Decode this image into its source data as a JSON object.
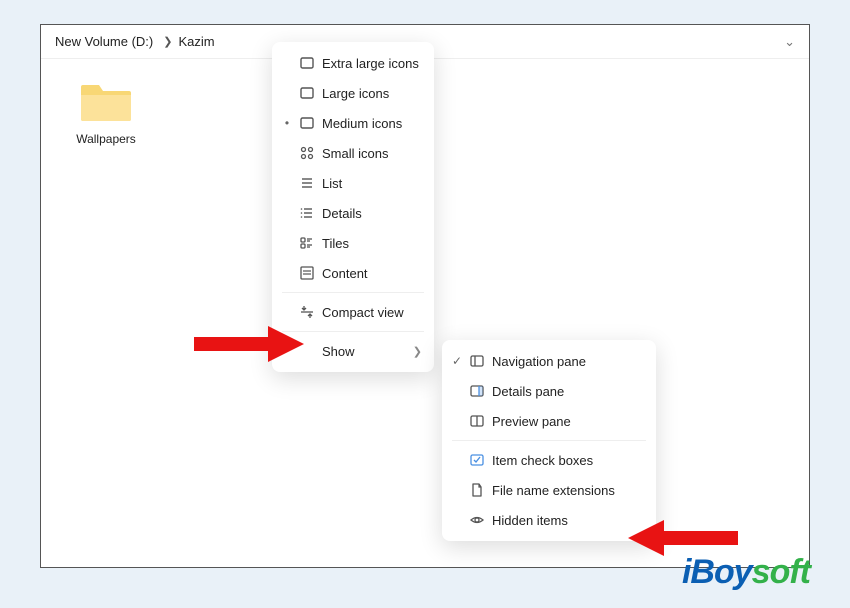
{
  "breadcrumb": {
    "item1": "New Volume (D:)",
    "item2": "Kazim"
  },
  "folder": {
    "name": "Wallpapers"
  },
  "viewMenu": {
    "items": [
      {
        "label": "Extra large icons",
        "icon": "xlarge"
      },
      {
        "label": "Large icons",
        "icon": "large"
      },
      {
        "label": "Medium icons",
        "icon": "medium",
        "selected": true
      },
      {
        "label": "Small icons",
        "icon": "small"
      },
      {
        "label": "List",
        "icon": "list"
      },
      {
        "label": "Details",
        "icon": "details"
      },
      {
        "label": "Tiles",
        "icon": "tiles"
      },
      {
        "label": "Content",
        "icon": "content"
      }
    ],
    "compact": {
      "label": "Compact view"
    },
    "show": {
      "label": "Show"
    }
  },
  "showMenu": {
    "items": [
      {
        "label": "Navigation pane",
        "icon": "navpane",
        "checked": true
      },
      {
        "label": "Details pane",
        "icon": "detailspane"
      },
      {
        "label": "Preview pane",
        "icon": "previewpane"
      }
    ],
    "items2": [
      {
        "label": "Item check boxes",
        "icon": "checkboxes"
      },
      {
        "label": "File name extensions",
        "icon": "extensions"
      },
      {
        "label": "Hidden items",
        "icon": "hidden"
      }
    ]
  },
  "brand": {
    "i": "iBoy",
    "soft": "soft"
  }
}
